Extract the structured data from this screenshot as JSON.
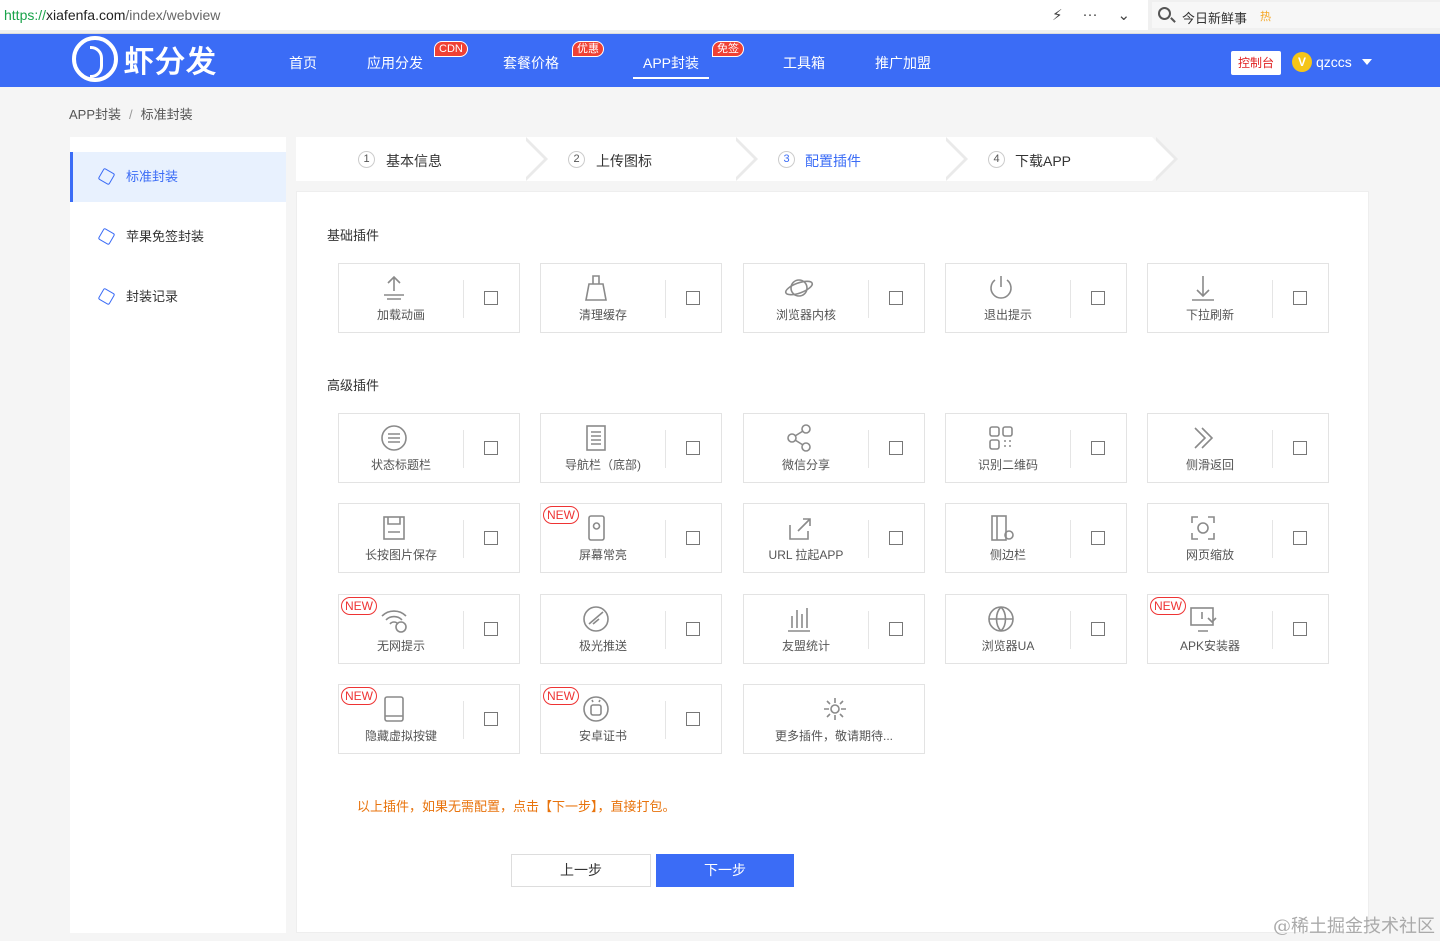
{
  "browser": {
    "url_scheme": "https://",
    "url_host": "xiafenfa.com",
    "url_path": "/index/webview",
    "search_text": "今日新鲜事",
    "search_hot": "热"
  },
  "nav": {
    "logo_text": "虾分发",
    "items": [
      {
        "label": "首页"
      },
      {
        "label": "应用分发",
        "badge": "CDN"
      },
      {
        "label": "套餐价格",
        "badge": "优惠"
      },
      {
        "label": "APP封装",
        "badge": "免签"
      },
      {
        "label": "工具箱"
      },
      {
        "label": "推广加盟"
      }
    ],
    "console": "控制台",
    "avatar_letter": "V",
    "username": "qzccs"
  },
  "breadcrumb": {
    "root": "APP封装",
    "sep": "/",
    "current": "标准封装"
  },
  "sidebar": {
    "items": [
      {
        "label": "标准封装"
      },
      {
        "label": "苹果免签封装"
      },
      {
        "label": "封装记录"
      }
    ]
  },
  "steps": [
    {
      "num": "1",
      "label": "基本信息"
    },
    {
      "num": "2",
      "label": "上传图标"
    },
    {
      "num": "3",
      "label": "配置插件"
    },
    {
      "num": "4",
      "label": "下载APP"
    }
  ],
  "sections": {
    "basic": "基础插件",
    "advanced": "高级插件"
  },
  "basic_plugins": [
    {
      "label": "加载动画",
      "icon": "upload-icon"
    },
    {
      "label": "清理缓存",
      "icon": "broom-icon"
    },
    {
      "label": "浏览器内核",
      "icon": "planet-icon"
    },
    {
      "label": "退出提示",
      "icon": "power-icon"
    },
    {
      "label": "下拉刷新",
      "icon": "pull-down-icon"
    }
  ],
  "advanced_plugins": [
    {
      "label": "状态标题栏",
      "icon": "menu-circle-icon"
    },
    {
      "label": "导航栏（底部)",
      "icon": "document-icon"
    },
    {
      "label": "微信分享",
      "icon": "share-icon"
    },
    {
      "label": "识别二维码",
      "icon": "qrcode-icon"
    },
    {
      "label": "侧滑返回",
      "icon": "double-chevron-icon"
    },
    {
      "label": "长按图片保存",
      "icon": "save-icon"
    },
    {
      "label": "屏幕常亮",
      "icon": "phone-sun-icon",
      "badge": "NEW"
    },
    {
      "label": "URL 拉起APP",
      "icon": "external-link-icon"
    },
    {
      "label": "侧边栏",
      "icon": "sidebar-icon"
    },
    {
      "label": "网页缩放",
      "icon": "zoom-frame-icon"
    },
    {
      "label": "无网提示",
      "icon": "wifi-off-icon",
      "badge": "NEW"
    },
    {
      "label": "极光推送",
      "icon": "push-icon"
    },
    {
      "label": "友盟统计",
      "icon": "bar-chart-icon"
    },
    {
      "label": "浏览器UA",
      "icon": "globe-icon"
    },
    {
      "label": "APK安装器",
      "icon": "installer-icon",
      "badge": "NEW"
    },
    {
      "label": "隐藏虚拟按键",
      "icon": "tablet-icon",
      "badge": "NEW"
    },
    {
      "label": "安卓证书",
      "icon": "android-icon",
      "badge": "NEW"
    }
  ],
  "more_plugins": {
    "label": "更多插件，敬请期待...",
    "icon": "gear-icon"
  },
  "hint": "以上插件，如果无需配置，点击【下一步】，直接打包。",
  "buttons": {
    "prev": "上一步",
    "next": "下一步"
  },
  "watermark": "@稀土掘金技术社区"
}
